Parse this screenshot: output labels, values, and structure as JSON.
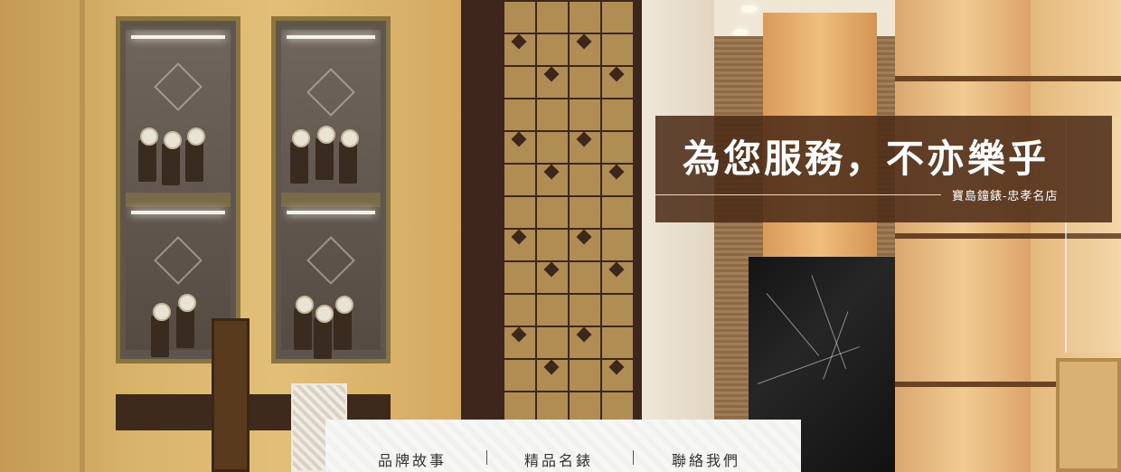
{
  "hero": {
    "headline": "為您服務，不亦樂乎",
    "subline": "寶島鐘錶-忠孝名店",
    "overlay_color": "#4b2a16"
  },
  "nav": {
    "items": [
      {
        "label": "品牌故事"
      },
      {
        "label": "精品名錶"
      },
      {
        "label": "聯絡我們"
      }
    ],
    "background": "#f7f7f5",
    "text_color": "#333333"
  }
}
